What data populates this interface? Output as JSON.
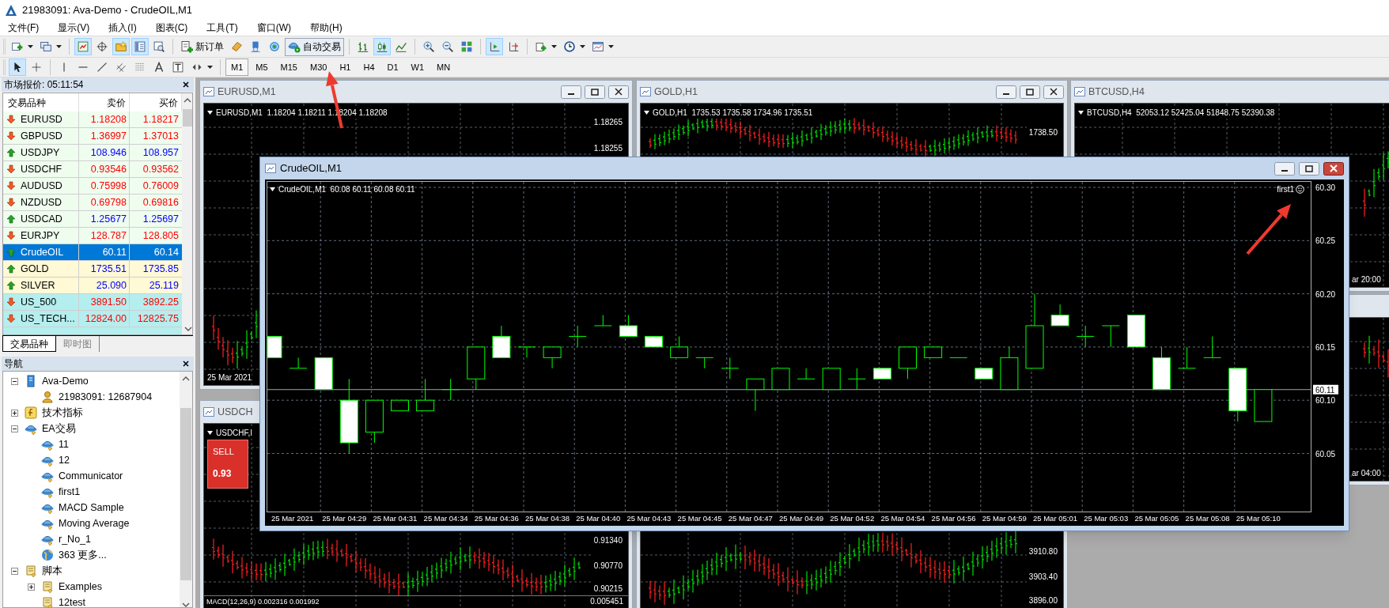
{
  "window": {
    "title": "21983091: Ava-Demo - CrudeOIL,M1"
  },
  "menu": [
    "文件(F)",
    "显示(V)",
    "插入(I)",
    "图表(C)",
    "工具(T)",
    "窗口(W)",
    "帮助(H)"
  ],
  "toolbar": {
    "market_watch_on": true,
    "data_window_on": false,
    "navigator_on": true,
    "terminal_on": true,
    "new_order": "新订单",
    "auto_trading": {
      "label": "自动交易",
      "on": true
    },
    "bar_chart_on": false,
    "candlestick_on": true,
    "line_chart_on": false,
    "auto_scroll": true,
    "chart_shift": false
  },
  "drawing_tools": {
    "cursor_on": true,
    "crosshair_on": false
  },
  "timeframes": [
    {
      "label": "M1",
      "selected": true
    },
    {
      "label": "M5",
      "selected": false
    },
    {
      "label": "M15",
      "selected": false
    },
    {
      "label": "M30",
      "selected": false
    },
    {
      "label": "H1",
      "selected": false
    },
    {
      "label": "H4",
      "selected": false
    },
    {
      "label": "D1",
      "selected": false
    },
    {
      "label": "W1",
      "selected": false
    },
    {
      "label": "MN",
      "selected": false
    }
  ],
  "market_watch": {
    "title": "市场报价: 05:11:54",
    "columns": [
      "交易品种",
      "卖价",
      "买价"
    ],
    "rows": [
      {
        "symbol": "EURUSD",
        "bid": "1.18208",
        "ask": "1.18217",
        "rising": false,
        "color": "#effdef",
        "selected": false
      },
      {
        "symbol": "GBPUSD",
        "bid": "1.36997",
        "ask": "1.37013",
        "rising": false,
        "color": "#effdef",
        "selected": false
      },
      {
        "symbol": "USDJPY",
        "bid": "108.946",
        "ask": "108.957",
        "rising": true,
        "color": "#effdef",
        "selected": false
      },
      {
        "symbol": "USDCHF",
        "bid": "0.93546",
        "ask": "0.93562",
        "rising": false,
        "color": "#effdef",
        "selected": false
      },
      {
        "symbol": "AUDUSD",
        "bid": "0.75998",
        "ask": "0.76009",
        "rising": false,
        "color": "#effdef",
        "selected": false
      },
      {
        "symbol": "NZDUSD",
        "bid": "0.69798",
        "ask": "0.69816",
        "rising": false,
        "color": "#effdef",
        "selected": false
      },
      {
        "symbol": "USDCAD",
        "bid": "1.25677",
        "ask": "1.25697",
        "rising": true,
        "color": "#effdef",
        "selected": false
      },
      {
        "symbol": "EURJPY",
        "bid": "128.787",
        "ask": "128.805",
        "rising": false,
        "color": "#effdef",
        "selected": false
      },
      {
        "symbol": "CrudeOIL",
        "bid": "60.11",
        "ask": "60.14",
        "rising": true,
        "selected": true
      },
      {
        "symbol": "GOLD",
        "bid": "1735.51",
        "ask": "1735.85",
        "rising": true,
        "color": "#fff9d6",
        "selected": false
      },
      {
        "symbol": "SILVER",
        "bid": "25.090",
        "ask": "25.119",
        "rising": true,
        "color": "#fff9d6",
        "selected": false
      },
      {
        "symbol": "US_500",
        "bid": "3891.50",
        "ask": "3892.25",
        "rising": false,
        "color": "#b4eeee",
        "selected": false
      },
      {
        "symbol": "US_TECH...",
        "bid": "12824.00",
        "ask": "12825.75",
        "rising": false,
        "color": "#b4eeee",
        "selected": false
      }
    ]
  },
  "market_watch_tabs": [
    {
      "label": "交易品种",
      "selected": true
    },
    {
      "label": "即时图",
      "selected": false
    }
  ],
  "navigator": {
    "title": "导航",
    "tree": [
      {
        "label": "Ava-Demo",
        "kind": "server",
        "expanded": true,
        "children": [
          {
            "label": "21983091: 12687904",
            "kind": "account"
          }
        ]
      },
      {
        "label": "技术指标",
        "kind": "indicators",
        "expanded": false
      },
      {
        "label": "EA交易",
        "kind": "experts",
        "expanded": true,
        "children": [
          {
            "label": "11",
            "kind": "expert"
          },
          {
            "label": "12",
            "kind": "expert"
          },
          {
            "label": "Communicator",
            "kind": "expert"
          },
          {
            "label": "first1",
            "kind": "expert"
          },
          {
            "label": "MACD Sample",
            "kind": "expert"
          },
          {
            "label": "Moving Average",
            "kind": "expert"
          },
          {
            "label": "r_No_1",
            "kind": "expert"
          },
          {
            "label": "363 更多...",
            "kind": "more"
          }
        ]
      },
      {
        "label": "脚本",
        "kind": "scripts",
        "expanded": true,
        "children": [
          {
            "label": "Examples",
            "kind": "scripts",
            "expanded": false
          },
          {
            "label": "12test",
            "kind": "script"
          }
        ]
      }
    ]
  },
  "chart_windows": [
    {
      "title": "EURUSD,M1",
      "header": "EURUSD,M1  1.18204 1.18211 1.18204 1.18208",
      "price_labels": [
        "1.18265",
        "1.18255"
      ],
      "time_labels": [
        "25 Mar 2021"
      ]
    },
    {
      "title": "GOLD,H1",
      "header": "GOLD,H1  1735.53 1735.58 1734.96 1735.51",
      "price_labels": [
        "1738.50"
      ]
    },
    {
      "title": "BTCUSD,H4",
      "header": "BTCUSD,H4  52053.12 52425.04 51848.75 52390.38",
      "time_labels": [
        "ar 20:00"
      ]
    },
    {
      "time_labels": [
        "ar 04:00"
      ]
    },
    {
      "title": "USDCH",
      "header": "USDCHF,I",
      "one_click": {
        "sell": "SELL",
        "price": "0.93"
      },
      "price_labels": [
        "0.91340",
        "0.90770",
        "0.90215"
      ],
      "indicator": "MACD(12,26,9) 0.002316 0.001992",
      "indicator_label": "0.005451"
    },
    {
      "price_labels": [
        "3910.80",
        "3903.40",
        "3896.00"
      ]
    }
  ],
  "active_chart": {
    "title": "CrudeOIL,M1",
    "header": "CrudeOIL,M1  60.08 60.11 60.08 60.11",
    "expert": "first1",
    "price_labels": [
      "60.30",
      "60.25",
      "60.20",
      "60.15",
      "60.10",
      "60.05"
    ],
    "current_price": "60.11",
    "time_labels": [
      "25 Mar 2021",
      "25 Mar 04:29",
      "25 Mar 04:31",
      "25 Mar 04:34",
      "25 Mar 04:36",
      "25 Mar 04:38",
      "25 Mar 04:40",
      "25 Mar 04:43",
      "25 Mar 04:45",
      "25 Mar 04:47",
      "25 Mar 04:49",
      "25 Mar 04:52",
      "25 Mar 04:54",
      "25 Mar 04:56",
      "25 Mar 04:59",
      "25 Mar 05:01",
      "25 Mar 05:03",
      "25 Mar 05:05",
      "25 Mar 05:08",
      "25 Mar 05:10"
    ]
  }
}
